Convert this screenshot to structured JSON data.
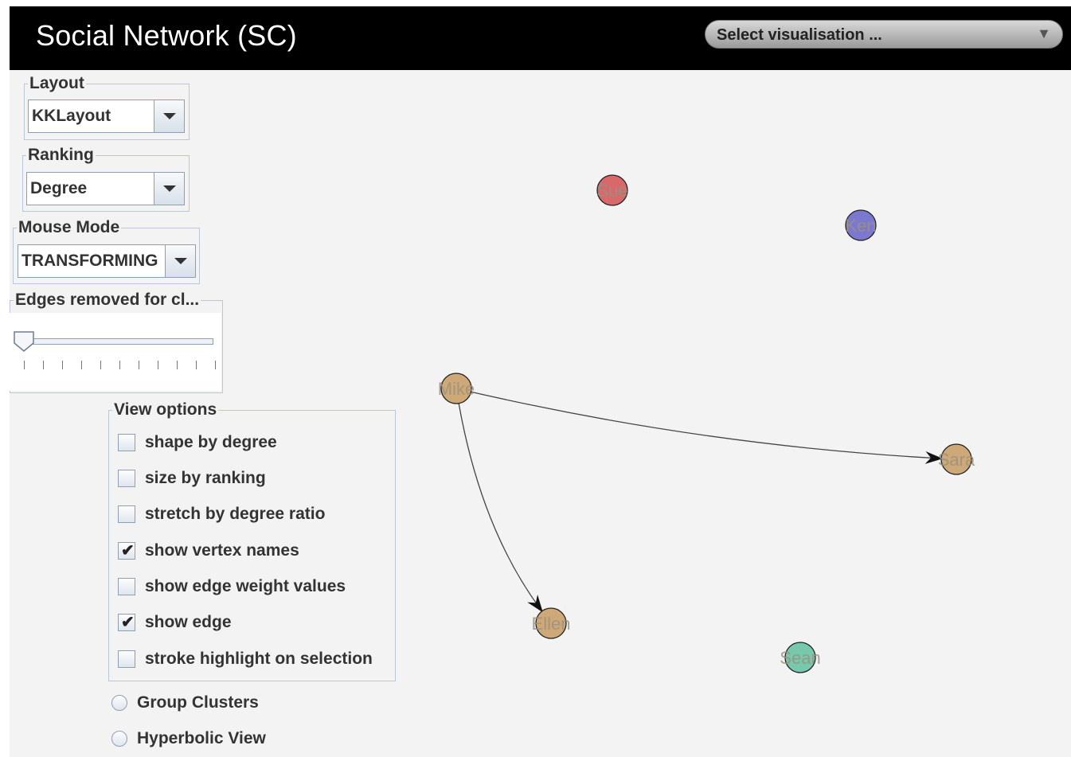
{
  "app": {
    "title": "Social Network (SC)"
  },
  "visualisation_select": {
    "value": "Select visualisation ...",
    "arrow": "▼"
  },
  "layout_group": {
    "legend": "Layout",
    "value": "KKLayout"
  },
  "ranking_group": {
    "legend": "Ranking",
    "value": "Degree"
  },
  "mouse_mode_group": {
    "legend": "Mouse Mode",
    "value": "TRANSFORMING"
  },
  "edges_slider": {
    "legend": "Edges removed for cl...",
    "value": 0,
    "tick_count": 11
  },
  "view_options": {
    "legend": "View options",
    "items": [
      {
        "label": "shape by degree",
        "checked": false
      },
      {
        "label": "size by ranking",
        "checked": false
      },
      {
        "label": "stretch by degree ratio",
        "checked": false
      },
      {
        "label": "show vertex names",
        "checked": true
      },
      {
        "label": "show edge weight values",
        "checked": false
      },
      {
        "label": "show edge",
        "checked": true
      },
      {
        "label": "stroke highlight on selection",
        "checked": false
      }
    ]
  },
  "radio_options": [
    {
      "label": "Group Clusters",
      "selected": false
    },
    {
      "label": "Hyperbolic View",
      "selected": false
    }
  ],
  "graph": {
    "vertices": [
      {
        "id": "sue",
        "label": "Sue",
        "color": "#d9686b"
      },
      {
        "id": "ken",
        "label": "Ken",
        "color": "#7b79cf"
      },
      {
        "id": "mike",
        "label": "Mike",
        "color": "#cfa878"
      },
      {
        "id": "sara",
        "label": "Sara",
        "color": "#cfa878"
      },
      {
        "id": "ellen",
        "label": "Ellen",
        "color": "#cfa878"
      },
      {
        "id": "sean",
        "label": "Sean",
        "color": "#77c9ad"
      }
    ],
    "edges": [
      {
        "from": "mike",
        "to": "sara"
      },
      {
        "from": "mike",
        "to": "ellen"
      }
    ]
  }
}
